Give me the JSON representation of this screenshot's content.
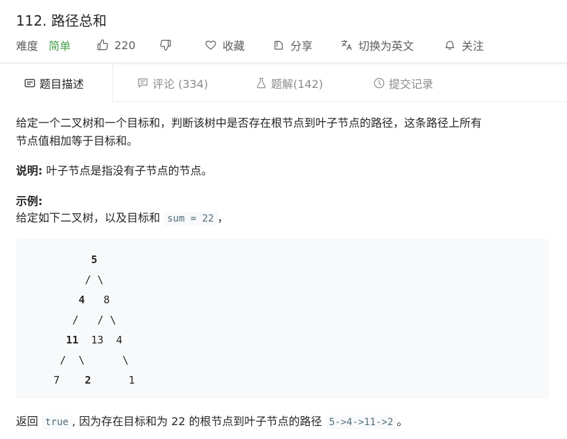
{
  "problem": {
    "title": "112. 路径总和",
    "difficulty_label": "难度",
    "difficulty_value": "简单",
    "likes": "220",
    "favorite_label": "收藏",
    "share_label": "分享",
    "translate_label": "切换为英文",
    "follow_label": "关注",
    "icons": {
      "like": "thumbs-up-icon",
      "dislike": "thumbs-down-icon",
      "favorite": "heart-icon",
      "share": "share-icon",
      "translate": "translate-icon",
      "follow": "bell-icon"
    }
  },
  "tabs": [
    {
      "label": "题目描述",
      "icon": "description-icon",
      "active": true
    },
    {
      "label": "评论 (334)",
      "icon": "comment-icon",
      "active": false
    },
    {
      "label": "题解(142)",
      "icon": "flask-icon",
      "active": false
    },
    {
      "label": "提交记录",
      "icon": "clock-icon",
      "active": false
    }
  ],
  "description": {
    "line1": "给定一个二叉树和一个目标和，判断该树中是否存在根节点到叶子节点的路径，这条路径上所有",
    "line2": "节点值相加等于目标和。",
    "note_label": "说明:",
    "note_text": " 叶子节点是指没有子节点的节点。",
    "example_label": "示例:",
    "example_intro": "给定如下二叉树，以及目标和 ",
    "example_sum": "sum = 22",
    "example_intro_end": "，",
    "tree_lines": [
      [
        "            ",
        "5",
        ""
      ],
      [
        "           / \\",
        "",
        ""
      ],
      [
        "          ",
        "4",
        "   8"
      ],
      [
        "         /   / \\",
        "",
        ""
      ],
      [
        "        ",
        "11",
        "  13  4"
      ],
      [
        "       /  \\      \\",
        "",
        ""
      ],
      [
        "      7    ",
        "2",
        "      1"
      ]
    ],
    "result_prefix": "返回 ",
    "result_value": "true",
    "result_middle": ", 因为存在目标和为 22 的根节点到叶子节点的路径 ",
    "result_path": "5->4->11->2",
    "result_end": "。"
  },
  "colors": {
    "easy": "#43a047",
    "code_bg": "#f7f9fa",
    "inline_code_text": "#546e7a"
  }
}
